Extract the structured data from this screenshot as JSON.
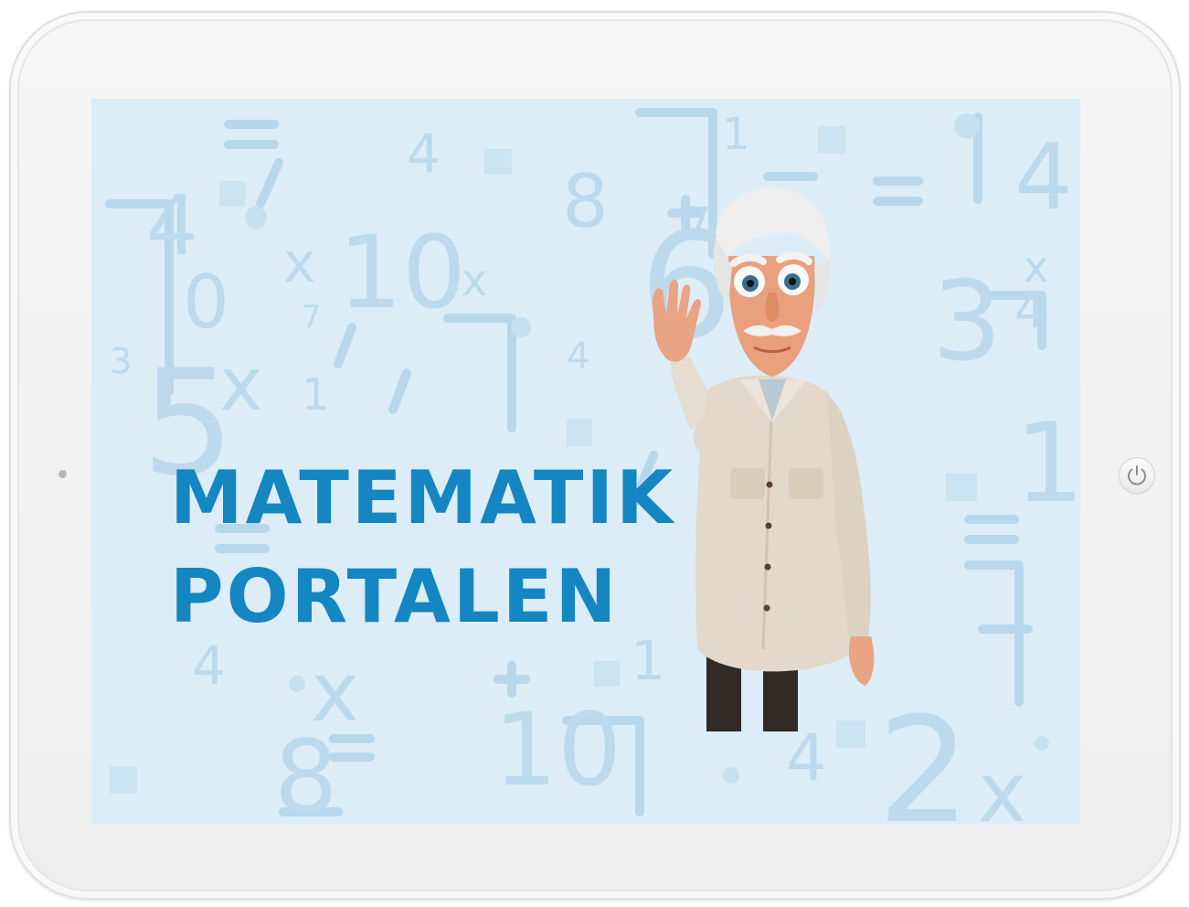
{
  "hero": {
    "title_line1": "MATEMATIK",
    "title_line2": "PORTALEN"
  },
  "device": {
    "home_button_icon": "power-icon"
  },
  "colors": {
    "title": "#1486c1",
    "screen_background": "#dcedf7",
    "background_symbols": "#b9d7ea",
    "tablet_frame": "#f2f2f2"
  }
}
